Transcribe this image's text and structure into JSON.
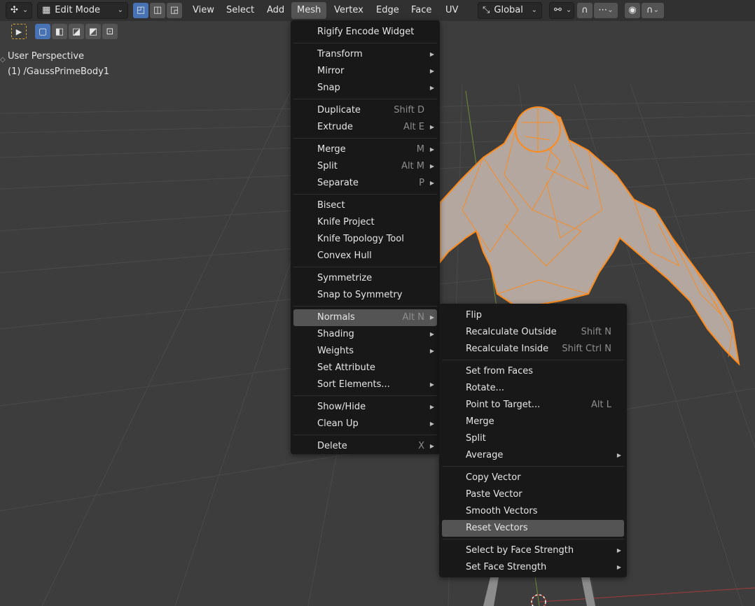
{
  "header": {
    "mode": "Edit Mode",
    "menus": [
      "View",
      "Select",
      "Add",
      "Mesh",
      "Vertex",
      "Edge",
      "Face",
      "UV"
    ],
    "active_menu": "Mesh",
    "orientation": "Global"
  },
  "overlay": {
    "view_name": "User Perspective",
    "object_name": "(1) /GaussPrimeBody1"
  },
  "mesh_menu": {
    "groups": [
      [
        {
          "label": "Rigify Encode Widget"
        }
      ],
      [
        {
          "label": "Transform",
          "sub": true
        },
        {
          "label": "Mirror",
          "sub": true
        },
        {
          "label": "Snap",
          "sub": true
        }
      ],
      [
        {
          "label": "Duplicate",
          "shortcut": "Shift D"
        },
        {
          "label": "Extrude",
          "shortcut": "Alt E",
          "sub": true
        }
      ],
      [
        {
          "label": "Merge",
          "shortcut": "M",
          "sub": true
        },
        {
          "label": "Split",
          "shortcut": "Alt M",
          "sub": true
        },
        {
          "label": "Separate",
          "shortcut": "P",
          "sub": true
        }
      ],
      [
        {
          "label": "Bisect"
        },
        {
          "label": "Knife Project"
        },
        {
          "label": "Knife Topology Tool"
        },
        {
          "label": "Convex Hull"
        }
      ],
      [
        {
          "label": "Symmetrize"
        },
        {
          "label": "Snap to Symmetry"
        }
      ],
      [
        {
          "label": "Normals",
          "shortcut": "Alt N",
          "sub": true,
          "highlight": true
        },
        {
          "label": "Shading",
          "sub": true
        },
        {
          "label": "Weights",
          "sub": true
        },
        {
          "label": "Set Attribute"
        },
        {
          "label": "Sort Elements...",
          "sub": true
        }
      ],
      [
        {
          "label": "Show/Hide",
          "sub": true
        },
        {
          "label": "Clean Up",
          "sub": true
        }
      ],
      [
        {
          "label": "Delete",
          "shortcut": "X",
          "sub": true
        }
      ]
    ]
  },
  "normals_menu": {
    "groups": [
      [
        {
          "label": "Flip"
        },
        {
          "label": "Recalculate Outside",
          "shortcut": "Shift N"
        },
        {
          "label": "Recalculate Inside",
          "shortcut": "Shift Ctrl N"
        }
      ],
      [
        {
          "label": "Set from Faces"
        },
        {
          "label": "Rotate..."
        },
        {
          "label": "Point to Target...",
          "shortcut": "Alt L"
        },
        {
          "label": "Merge"
        },
        {
          "label": "Split"
        },
        {
          "label": "Average",
          "sub": true
        }
      ],
      [
        {
          "label": "Copy Vector"
        },
        {
          "label": "Paste Vector"
        },
        {
          "label": "Smooth Vectors"
        },
        {
          "label": "Reset Vectors",
          "highlight": true
        }
      ],
      [
        {
          "label": "Select by Face Strength",
          "sub": true
        },
        {
          "label": "Set Face Strength",
          "sub": true
        }
      ]
    ]
  },
  "colors": {
    "background": "#3d3d3d",
    "mesh_wire": "#ff8a1a",
    "mesh_fill": "#b3a79f",
    "accent": "#4772b3"
  }
}
